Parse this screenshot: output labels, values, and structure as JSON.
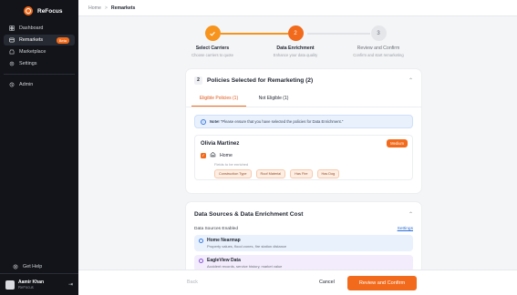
{
  "app": {
    "name": "ReFocus",
    "accent": "#f26a1b"
  },
  "sidebar": {
    "items": [
      {
        "label": "Dashboard",
        "icon": "dashboard-icon"
      },
      {
        "label": "Remarkets",
        "icon": "remarkets-icon",
        "badge": "Beta",
        "active": true
      },
      {
        "label": "Marketplace",
        "icon": "marketplace-icon"
      },
      {
        "label": "Settings",
        "icon": "settings-icon"
      },
      {
        "label": "Admin",
        "icon": "admin-icon"
      }
    ],
    "help_label": "Get Help",
    "user": {
      "name": "Aamir Khan",
      "org": "ReFocus"
    }
  },
  "breadcrumb": {
    "home": "Home",
    "separator": ">",
    "current": "Remarkets"
  },
  "stepper": {
    "steps": [
      {
        "number": "1",
        "title": "Select Carriers",
        "subtitle": "Choose carriers to quote",
        "state": "done"
      },
      {
        "number": "2",
        "title": "Data Enrichment",
        "subtitle": "Enhance your data quality",
        "state": "current"
      },
      {
        "number": "3",
        "title": "Review and Confirm",
        "subtitle": "Confirm and start remarketing",
        "state": "todo"
      }
    ]
  },
  "policies_card": {
    "count": "2",
    "title": "Policies Selected for Remarketing (2)",
    "tabs": [
      "Eligible Policies (1)",
      "Not Eligible (1)"
    ],
    "note_bold": "Note!",
    "note_text": " \"Please ensure that you have selected the policies for Data Enrichment.\"",
    "policy": {
      "holder": "Olivia Martinez",
      "priority": "Medium",
      "type": "Home",
      "fields_label": "Fields to be enriched",
      "fields": [
        "Construction Type",
        "Roof Material",
        "Has Fire",
        "Has Dog"
      ]
    }
  },
  "sources_card": {
    "title": "Data Sources & Data Enrichment Cost",
    "enabled_label": "Data Sources Enabled",
    "settings_link": "Settings",
    "sources": [
      {
        "name": "Home Nearmap",
        "description": "Property values, flood zones, fire station distance",
        "color": "#e9f1fd"
      },
      {
        "name": "EagleView Data",
        "description": "Accident records, service history, market value",
        "color": "#f3ecfc"
      }
    ]
  },
  "footer": {
    "back": "Back",
    "cancel": "Cancel",
    "primary": "Review and Confirm"
  }
}
